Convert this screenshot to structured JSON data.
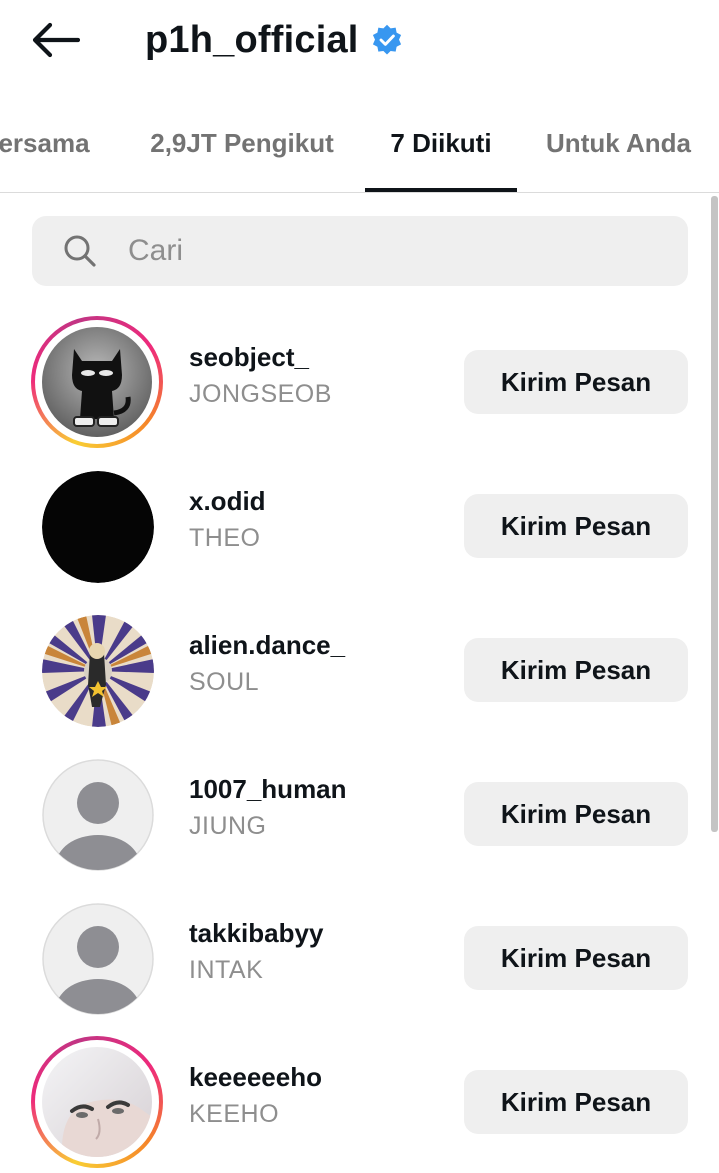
{
  "header": {
    "title": "p1h_official",
    "verified": true,
    "back_icon": "arrow-left-icon",
    "verified_icon": "verified-badge-icon"
  },
  "tabs": [
    {
      "label": "ersama",
      "active": false
    },
    {
      "label": "2,9JT Pengikut",
      "active": false
    },
    {
      "label": "7 Diikuti",
      "active": true
    },
    {
      "label": "Untuk Anda",
      "active": false
    }
  ],
  "search": {
    "placeholder": "Cari",
    "value": "",
    "icon": "search-icon"
  },
  "following": [
    {
      "username": "seobject_",
      "fullname": "JONGSEOB",
      "button": "Kirim Pesan",
      "story_ring": true,
      "avatar": "cat-illustration"
    },
    {
      "username": "x.odid",
      "fullname": "THEO",
      "button": "Kirim Pesan",
      "story_ring": false,
      "avatar": "black"
    },
    {
      "username": "alien.dance_",
      "fullname": "SOUL",
      "button": "Kirim Pesan",
      "story_ring": false,
      "avatar": "psychedelic-pattern"
    },
    {
      "username": "1007_human",
      "fullname": "JIUNG",
      "button": "Kirim Pesan",
      "story_ring": false,
      "avatar": "default-user-icon"
    },
    {
      "username": "takkibabyy",
      "fullname": "INTAK",
      "button": "Kirim Pesan",
      "story_ring": false,
      "avatar": "default-user-icon"
    },
    {
      "username": "keeeeeeho",
      "fullname": "KEEHO",
      "button": "Kirim Pesan",
      "story_ring": true,
      "avatar": "portrait-photo"
    }
  ],
  "colors": {
    "accent_verified": "#3897f0",
    "button_bg": "#efefef",
    "muted_text": "#8e8e8e"
  }
}
